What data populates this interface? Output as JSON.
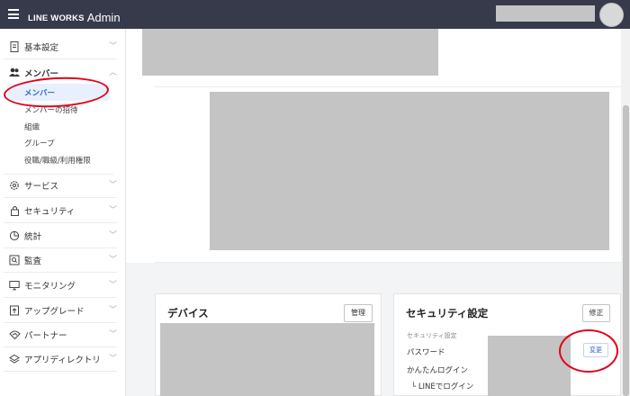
{
  "header": {
    "brand": "LINE WORKS",
    "product": "Admin"
  },
  "sidebar": {
    "items": [
      {
        "label": "基本設定",
        "icon": "document-icon"
      },
      {
        "label": "メンバー",
        "icon": "users-icon"
      },
      {
        "label": "サービス",
        "icon": "gear-icon"
      },
      {
        "label": "セキュリティ",
        "icon": "lock-icon"
      },
      {
        "label": "統計",
        "icon": "pie-chart-icon"
      },
      {
        "label": "監査",
        "icon": "magnifier-icon"
      },
      {
        "label": "モニタリング",
        "icon": "monitor-icon"
      },
      {
        "label": "アップグレード",
        "icon": "upgrade-icon"
      },
      {
        "label": "パートナー",
        "icon": "handshake-icon"
      },
      {
        "label": "アプリディレクトリ",
        "icon": "layers-icon"
      }
    ],
    "member_sub": [
      {
        "label": "メンバー",
        "active": true
      },
      {
        "label": "メンバーの招待"
      },
      {
        "label": "組織"
      },
      {
        "label": "グループ"
      },
      {
        "label": "役職/職級/利用権限"
      }
    ]
  },
  "device_card": {
    "title": "デバイス",
    "manage_button": "管理"
  },
  "security_card": {
    "title": "セキュリティ設定",
    "edit_button": "修正",
    "caption": "セキュリティ設定",
    "rows": [
      {
        "label": "パスワード"
      },
      {
        "label": "かんたんログイン"
      },
      {
        "label": "└ LINEでログイン"
      }
    ],
    "change_button": "変更"
  },
  "colors": {
    "header_bg": "#373a4b",
    "accent": "#2c65d6",
    "annotation": "#e2001a",
    "placeholder": "#c4c4c4"
  }
}
